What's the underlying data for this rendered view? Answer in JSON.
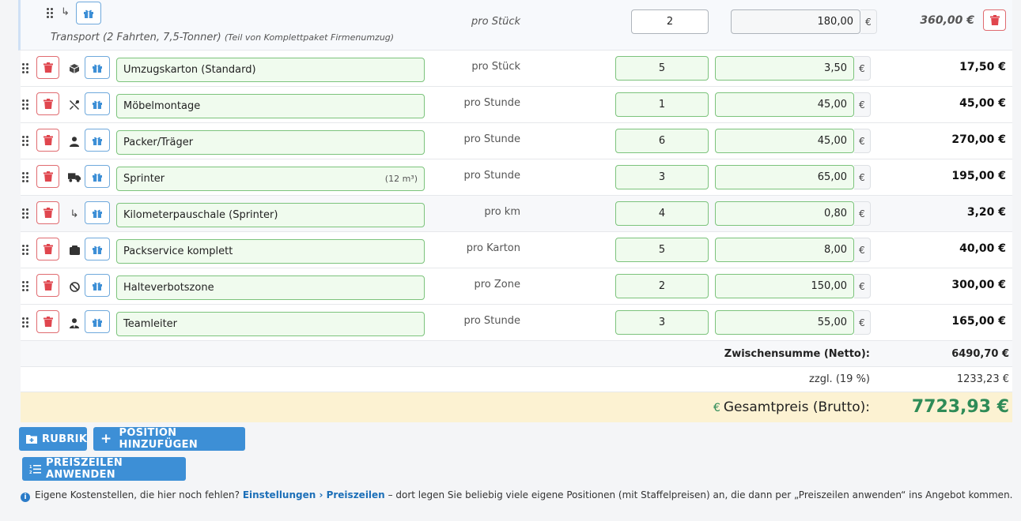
{
  "sub_item": {
    "unit": "pro Stück",
    "qty": "2",
    "price": "180,00",
    "currency": "€",
    "total": "360,00 €",
    "description": "Transport (2 Fahrten, 7,5-Tonner)",
    "description_note": "(Teil von Komplettpaket Firmenumzug)"
  },
  "items": [
    {
      "icon": "box-icon",
      "name": "Umzugskarton (Standard)",
      "extra": "",
      "unit": "pro Stück",
      "qty": "5",
      "price": "3,50",
      "currency": "€",
      "total": "17,50 €"
    },
    {
      "icon": "tools-icon",
      "name": "Möbelmontage",
      "extra": "",
      "unit": "pro Stunde",
      "qty": "1",
      "price": "45,00",
      "currency": "€",
      "total": "45,00 €"
    },
    {
      "icon": "person-icon",
      "name": "Packer/Träger",
      "extra": "",
      "unit": "pro Stunde",
      "qty": "6",
      "price": "45,00",
      "currency": "€",
      "total": "270,00 €"
    },
    {
      "icon": "truck-icon",
      "name": "Sprinter",
      "extra": "(12 m³)",
      "unit": "pro Stunde",
      "qty": "3",
      "price": "65,00",
      "currency": "€",
      "total": "195,00 €"
    },
    {
      "icon": "sub-arrow-icon",
      "name": "Kilometerpauschale (Sprinter)",
      "extra": "",
      "unit": "pro km",
      "qty": "4",
      "price": "0,80",
      "currency": "€",
      "total": "3,20 €"
    },
    {
      "icon": "package-icon",
      "name": "Packservice komplett",
      "extra": "",
      "unit": "pro Karton",
      "qty": "5",
      "price": "8,00",
      "currency": "€",
      "total": "40,00 €"
    },
    {
      "icon": "no-parking-icon",
      "name": "Halteverbotszone",
      "extra": "",
      "unit": "pro Zone",
      "qty": "2",
      "price": "150,00",
      "currency": "€",
      "total": "300,00 €"
    },
    {
      "icon": "lead-person-icon",
      "name": "Teamleiter",
      "extra": "",
      "unit": "pro Stunde",
      "qty": "3",
      "price": "55,00",
      "currency": "€",
      "total": "165,00 €"
    }
  ],
  "summary": {
    "subtotal_label": "Zwischensumme (Netto):",
    "subtotal_value": "6490,70 €",
    "tax_label": "zzgl. (19 %)",
    "tax_value": "1233,23 €",
    "grand_currency": "€",
    "grand_label": "Gesamtpreis (Brutto):",
    "grand_value": "7723,93 €"
  },
  "actions": {
    "rubrik": "RUBRIK",
    "add_position": "POSITION HINZUFÜGEN",
    "apply_price_rows": "PREISZEILEN ANWENDEN"
  },
  "info": {
    "prefix": "Eigene Kostenstellen, die hier noch fehlen?",
    "link": "Einstellungen › Preiszeilen",
    "suffix": "– dort legen Sie beliebig viele eigene Positionen (mit Staffelpreisen) an, die dann per „Preiszeilen anwenden“ ins Angebot kommen."
  },
  "colors": {
    "accent": "#3d8fd6",
    "delete": "#e0464e",
    "input_green_bg": "#f0fbee",
    "input_green_border": "#7cc37c",
    "grand_bg": "#fcf2d2",
    "grand_text": "#2e8b57"
  }
}
